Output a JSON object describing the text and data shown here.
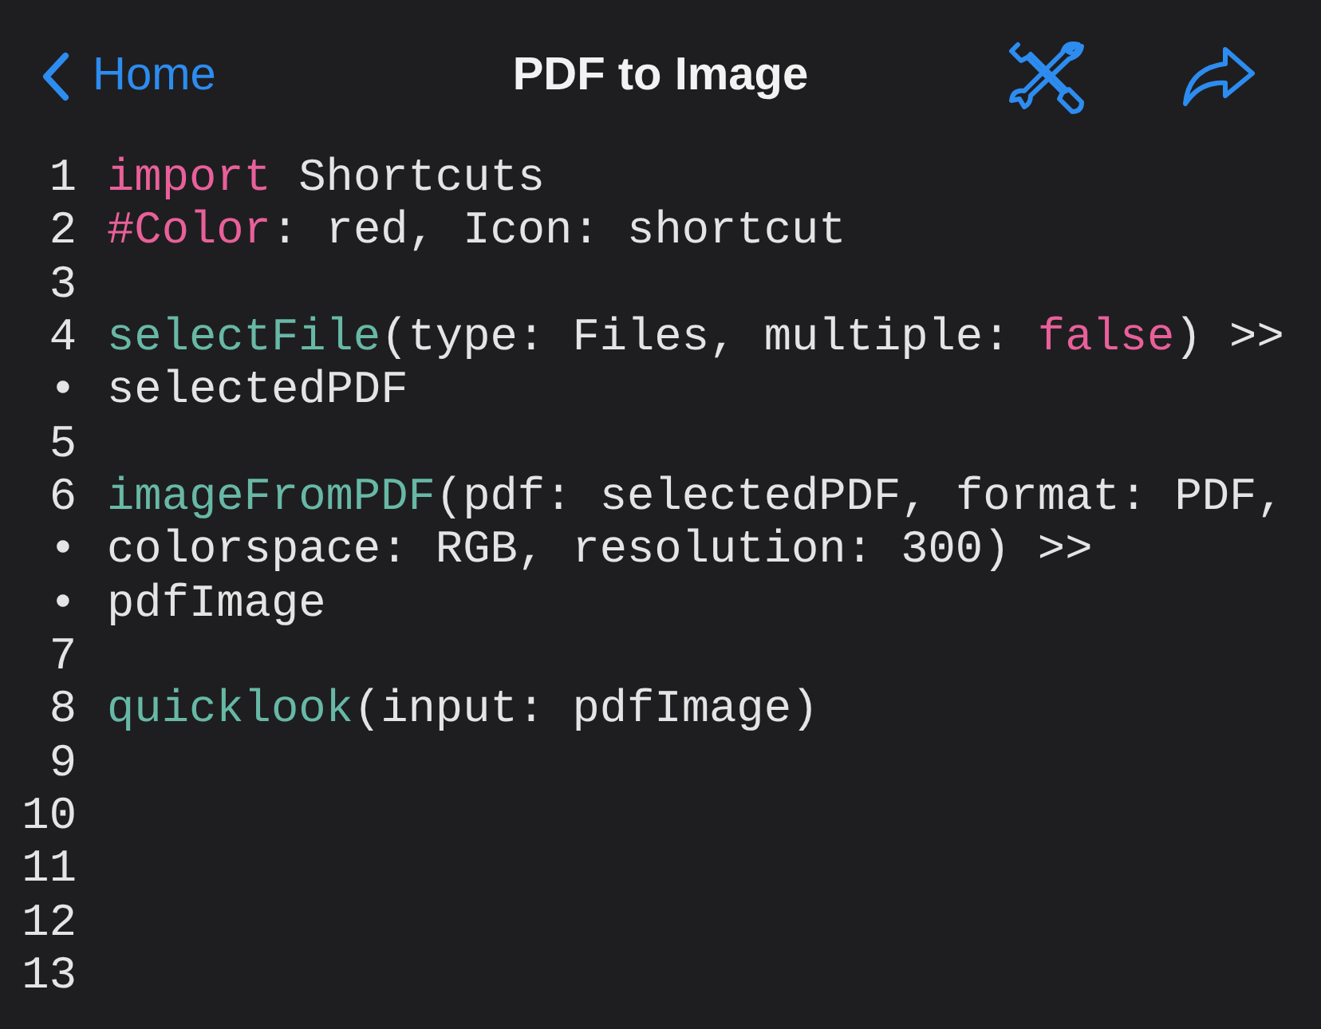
{
  "nav_bar": {
    "back_label": "Home",
    "title": "PDF to Image"
  },
  "editor": {
    "lines": [
      {
        "gutter": "1",
        "tokens": [
          {
            "kind": "keyword",
            "text": "import"
          },
          {
            "kind": "plain",
            "text": " Shortcuts"
          }
        ]
      },
      {
        "gutter": "2",
        "tokens": [
          {
            "kind": "keyword",
            "text": "#Color"
          },
          {
            "kind": "plain",
            "text": ": red, Icon: shortcut"
          }
        ]
      },
      {
        "gutter": "3"
      },
      {
        "gutter": "4",
        "tokens": [
          {
            "kind": "function",
            "text": "selectFile"
          },
          {
            "kind": "plain",
            "text": "(type: Files, multiple: "
          },
          {
            "kind": "keyword",
            "text": "false"
          },
          {
            "kind": "plain",
            "text": ") >>"
          }
        ]
      },
      {
        "gutter": "•",
        "tokens": [
          {
            "kind": "plain",
            "text": "selectedPDF"
          }
        ]
      },
      {
        "gutter": "5"
      },
      {
        "gutter": "6",
        "tokens": [
          {
            "kind": "function",
            "text": "imageFromPDF"
          },
          {
            "kind": "plain",
            "text": "(pdf: selectedPDF, format: PDF,"
          }
        ]
      },
      {
        "gutter": "•",
        "tokens": [
          {
            "kind": "plain",
            "text": "colorspace: RGB, resolution: 300) >>"
          }
        ]
      },
      {
        "gutter": "•",
        "tokens": [
          {
            "kind": "plain",
            "text": "pdfImage"
          }
        ]
      },
      {
        "gutter": "7"
      },
      {
        "gutter": "8",
        "tokens": [
          {
            "kind": "function",
            "text": "quicklook"
          },
          {
            "kind": "plain",
            "text": "(input: pdfImage)"
          }
        ]
      },
      {
        "gutter": "9"
      },
      {
        "gutter": "10"
      },
      {
        "gutter": "11"
      },
      {
        "gutter": "12"
      },
      {
        "gutter": "13"
      }
    ]
  }
}
